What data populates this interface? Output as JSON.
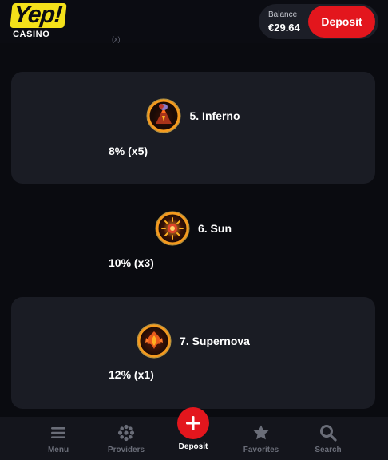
{
  "header": {
    "logo_text": "Yep!",
    "logo_sub": "CASINO",
    "balance_label": "Balance",
    "balance_value": "€29.64",
    "deposit_label": "Deposit"
  },
  "scroll_hint": "(x)",
  "levels": [
    {
      "name": "5. Inferno",
      "rate": "8% (x5)",
      "icon": "inferno-icon"
    },
    {
      "name": "6. Sun",
      "rate": "10% (x3)",
      "icon": "sun-icon"
    },
    {
      "name": "7. Supernova",
      "rate": "12% (x1)",
      "icon": "supernova-icon"
    }
  ],
  "bottom_nav": [
    {
      "label": "Menu",
      "icon": "menu-icon"
    },
    {
      "label": "Providers",
      "icon": "providers-icon"
    },
    {
      "label": "Deposit",
      "icon": "plus-icon"
    },
    {
      "label": "Favorites",
      "icon": "star-icon"
    },
    {
      "label": "Search",
      "icon": "search-icon"
    }
  ],
  "colors": {
    "background": "#0a0b10",
    "card": "#1a1c24",
    "accent_red": "#e3161d",
    "logo_yellow": "#f4e11a",
    "nav_inactive": "#6a6d78"
  }
}
